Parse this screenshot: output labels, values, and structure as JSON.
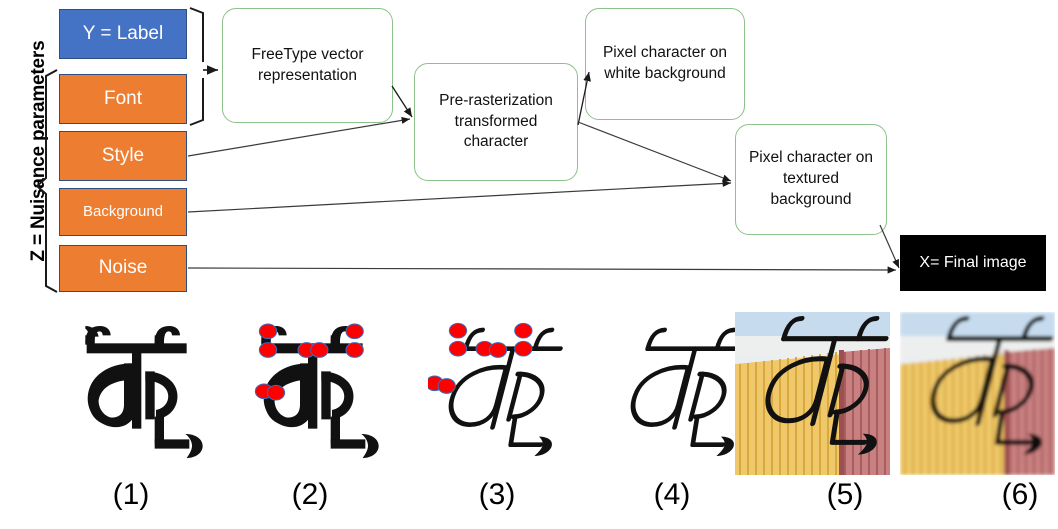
{
  "diagram": {
    "axis_label": "Z = Nuisance parameters",
    "parameters": [
      {
        "id": "label",
        "text": "Y = Label",
        "color": "#4472C4",
        "kind": "label"
      },
      {
        "id": "font",
        "text": "Font",
        "color": "#ED7D31",
        "kind": "nuisance"
      },
      {
        "id": "style",
        "text": "Style",
        "color": "#ED7D31",
        "kind": "nuisance"
      },
      {
        "id": "background",
        "text": "Background",
        "color": "#ED7D31",
        "kind": "nuisance"
      },
      {
        "id": "noise",
        "text": "Noise",
        "color": "#ED7D31",
        "kind": "nuisance"
      }
    ],
    "stages": [
      {
        "id": "freetype",
        "text": "FreeType vector representation",
        "border": "#8DC08A"
      },
      {
        "id": "prerast",
        "text": "Pre-rasterization transformed character",
        "border": "#8DC08A"
      },
      {
        "id": "pixel-white",
        "text": "Pixel character on white background",
        "border": "#8DC08A"
      },
      {
        "id": "pixel-texture",
        "text": "Pixel character on textured background",
        "border": "#8DC08A"
      }
    ],
    "final": {
      "id": "final-image",
      "text": "X= Final image",
      "color": "#000000",
      "text_color": "#FFFFFF"
    },
    "arrows": [
      {
        "from": "label+font bracket",
        "to": "freetype"
      },
      {
        "from": "freetype",
        "to": "prerast"
      },
      {
        "from": "style",
        "to": "prerast"
      },
      {
        "from": "prerast",
        "to": "pixel-white"
      },
      {
        "from": "prerast",
        "to": "pixel-texture"
      },
      {
        "from": "background",
        "to": "pixel-texture"
      },
      {
        "from": "pixel-texture",
        "to": "final-image"
      },
      {
        "from": "noise",
        "to": "final-image"
      }
    ]
  },
  "examples": {
    "captions": [
      "(1)",
      "(2)",
      "(3)",
      "(4)",
      "(5)",
      "(6)"
    ],
    "items": [
      {
        "caption": "(1)",
        "description": "upright black glyph on white",
        "slant": 0,
        "control_points": false,
        "background": "white",
        "blur": 0
      },
      {
        "caption": "(2)",
        "description": "upright glyph with red control points",
        "slant": 0,
        "control_points": true,
        "background": "white",
        "blur": 0
      },
      {
        "caption": "(3)",
        "description": "slanted glyph with red control points",
        "slant": 14,
        "control_points": true,
        "background": "white",
        "blur": 0
      },
      {
        "caption": "(4)",
        "description": "slanted glyph outline on white",
        "slant": 14,
        "control_points": false,
        "background": "white",
        "blur": 0
      },
      {
        "caption": "(5)",
        "description": "slanted glyph on textured fence photo",
        "slant": 14,
        "control_points": false,
        "background": "texture",
        "blur": 0
      },
      {
        "caption": "(6)",
        "description": "slanted glyph on textured photo, blurred",
        "slant": 14,
        "control_points": false,
        "background": "texture",
        "blur": 2
      }
    ],
    "control_point_color": "#FF0000",
    "control_point_stroke": "#3A6BBF",
    "texture_colors": {
      "sky": "#CFE2F0",
      "fence_light": "#F0C75E",
      "fence_dark": "#D9A93C",
      "post": "#B85C5C"
    }
  }
}
